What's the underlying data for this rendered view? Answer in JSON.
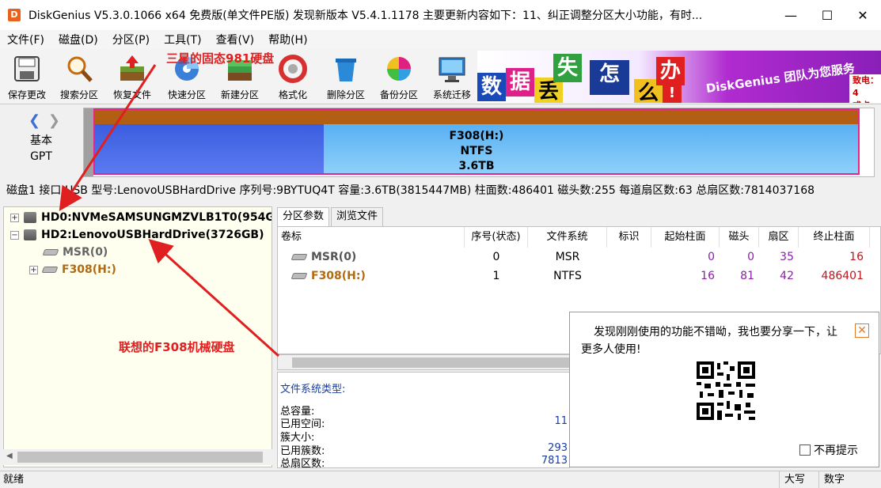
{
  "window": {
    "app_icon_letter": "D",
    "title": "DiskGenius V5.3.0.1066 x64 免费版(单文件PE版)  发现新版本 V5.4.1.1178 主要更新内容如下：11、纠正调整分区大小功能，有时...",
    "min": "—",
    "max": "☐",
    "close": "✕"
  },
  "menu": [
    "文件(F)",
    "磁盘(D)",
    "分区(P)",
    "工具(T)",
    "查看(V)",
    "帮助(H)"
  ],
  "toolbar": [
    {
      "label": "保存更改",
      "icon": "save-icon"
    },
    {
      "label": "搜索分区",
      "icon": "search-icon"
    },
    {
      "label": "恢复文件",
      "icon": "recover-icon"
    },
    {
      "label": "快速分区",
      "icon": "quick-partition-icon"
    },
    {
      "label": "新建分区",
      "icon": "new-partition-icon"
    },
    {
      "label": "格式化",
      "icon": "format-icon"
    },
    {
      "label": "删除分区",
      "icon": "delete-icon"
    },
    {
      "label": "备份分区",
      "icon": "backup-icon"
    },
    {
      "label": "系统迁移",
      "icon": "migrate-icon"
    }
  ],
  "banner": {
    "tiles": [
      "数",
      "据",
      "丢",
      "失",
      "怎",
      "么",
      "办",
      "!"
    ],
    "slogan": "DiskGenius 团队为您服务",
    "right_text_1": "致电：4",
    "right_text_2": "或点"
  },
  "disk_bar": {
    "disk_type_line1": "基本",
    "disk_type_line2": "GPT",
    "partition_name": "F308(H:)",
    "partition_fs": "NTFS",
    "partition_size": "3.6TB",
    "used_fraction": 0.3
  },
  "disk_info": "磁盘1 接口:USB  型号:LenovoUSBHardDrive  序列号:9BYTUQ4T  容量:3.6TB(3815447MB)  柱面数:486401  磁头数:255  每道扇区数:63  总扇区数:7814037168",
  "tree": {
    "hd0": "HD0:NVMeSAMSUNGMZVLB1T0(954G",
    "hd2": "HD2:LenovoUSBHardDrive(3726GB)",
    "msr": "MSR(0)",
    "f308": "F308(H:)"
  },
  "tabs": [
    "分区参数",
    "浏览文件"
  ],
  "grid": {
    "headers": [
      "卷标",
      "序号(状态)",
      "文件系统",
      "标识",
      "起始柱面",
      "磁头",
      "扇区",
      "终止柱面"
    ],
    "rows": [
      {
        "label": "MSR(0)",
        "seq": "0",
        "fs": "MSR",
        "flag": "",
        "start_cyl": "0",
        "head": "0",
        "sector": "35",
        "end_cyl": "16"
      },
      {
        "label": "F308(H:)",
        "seq": "1",
        "fs": "NTFS",
        "flag": "",
        "start_cyl": "16",
        "head": "81",
        "sector": "42",
        "end_cyl": "486401"
      }
    ]
  },
  "fs_info": {
    "type_label": "文件系统类型:",
    "total_label": "总容量:",
    "used_label": "已用空间:",
    "cluster_label": "簇大小:",
    "used_clusters_label": "已用簇数:",
    "total_sectors_label": "总扇区数:",
    "used_value": "11",
    "used_clusters_value": "293",
    "total_sectors_value": "7813"
  },
  "popup": {
    "message": "发现刚刚使用的功能不错呦，我也要分享一下，让更多人使用!",
    "close": "✕",
    "checkbox_label": "不再提示"
  },
  "status": {
    "left": "就绪",
    "caps": "大写",
    "num": "数字"
  },
  "annotations": {
    "samsung": "三星的固态981硬盘",
    "lenovo": "联想的F308机械硬盘"
  },
  "colors": {
    "accent_red": "#e02020",
    "partition_border": "#e8238a",
    "partition_used": "#3b5de0",
    "partition_free": "#8fd0fa",
    "partition_top": "#b25f14"
  }
}
